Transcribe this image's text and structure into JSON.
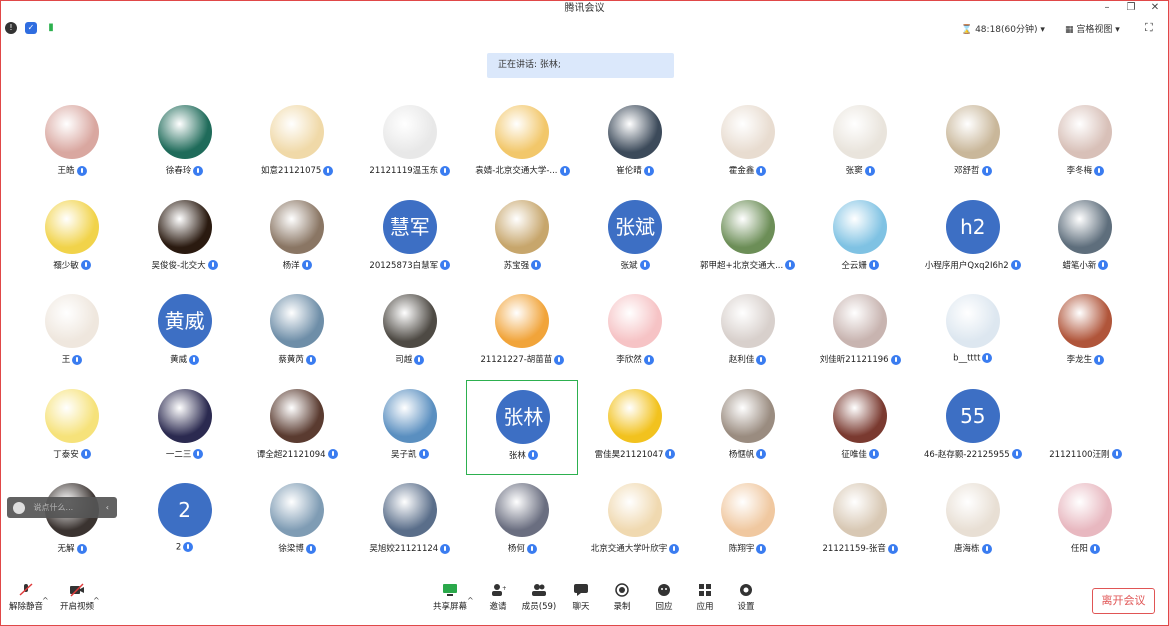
{
  "window": {
    "title": "腾讯会议"
  },
  "header": {
    "timer": "48:18(60分钟)",
    "view_mode": "宫格视图"
  },
  "speaking": {
    "text": "正在讲话: 张林;"
  },
  "participants": [
    {
      "name": "王皓",
      "avatar": "photo",
      "color": "#d9a7a0"
    },
    {
      "name": "徐春玲",
      "avatar": "photo",
      "color": "#1f6b5a"
    },
    {
      "name": "如意21121075",
      "avatar": "photo",
      "color": "#f0d9a8"
    },
    {
      "name": "21121119温玉东",
      "avatar": "photo",
      "color": "#e8e8e8"
    },
    {
      "name": "袁婧-北京交通大学-...",
      "avatar": "photo",
      "color": "#f2c76a"
    },
    {
      "name": "崔伦晴",
      "avatar": "photo",
      "color": "#3c4a5a"
    },
    {
      "name": "霍金鑫",
      "avatar": "photo",
      "color": "#e8dcd0"
    },
    {
      "name": "张窦",
      "avatar": "photo",
      "color": "#e9e4dc"
    },
    {
      "name": "邓舒哲",
      "avatar": "photo",
      "color": "#c9b79a"
    },
    {
      "name": "李冬梅",
      "avatar": "photo",
      "color": "#d8c0b8"
    },
    {
      "name": "禤少敏",
      "avatar": "photo",
      "color": "#f1d34a"
    },
    {
      "name": "吴俊俊-北交大",
      "avatar": "photo",
      "color": "#2a1a10"
    },
    {
      "name": "杨洋",
      "avatar": "photo",
      "color": "#8a7664"
    },
    {
      "name": "20125873白慧军",
      "avatar": "text",
      "text": "慧军"
    },
    {
      "name": "苏宝强",
      "avatar": "photo",
      "color": "#c7a66c"
    },
    {
      "name": "张斌",
      "avatar": "text",
      "text": "张斌"
    },
    {
      "name": "郭甲超+北京交通大...",
      "avatar": "photo",
      "color": "#6c8e57"
    },
    {
      "name": "仝云姗",
      "avatar": "photo",
      "color": "#7fc2e3"
    },
    {
      "name": "小程序用户Qxq2I6h2",
      "avatar": "text",
      "text": "h2"
    },
    {
      "name": "蜡笔小新",
      "avatar": "photo",
      "color": "#5e6e7c"
    },
    {
      "name": "王",
      "avatar": "photo",
      "color": "#efe7de"
    },
    {
      "name": "黄威",
      "avatar": "text",
      "text": "黄威"
    },
    {
      "name": "蔡黄芮",
      "avatar": "photo",
      "color": "#6e8ea8"
    },
    {
      "name": "司越",
      "avatar": "photo",
      "color": "#4e4a44"
    },
    {
      "name": "21121227-胡苗苗",
      "avatar": "photo",
      "color": "#f1a43a"
    },
    {
      "name": "李欣然",
      "avatar": "photo",
      "color": "#f6c3c5"
    },
    {
      "name": "赵利佳",
      "avatar": "photo",
      "color": "#d8d0cc"
    },
    {
      "name": "刘佳昕21121196",
      "avatar": "photo",
      "color": "#c8b4b0"
    },
    {
      "name": "b__tttt",
      "avatar": "photo",
      "color": "#dde7f0"
    },
    {
      "name": "李龙生",
      "avatar": "photo",
      "color": "#b0553a"
    },
    {
      "name": "丁泰安",
      "avatar": "photo",
      "color": "#f6e27a"
    },
    {
      "name": "一二三",
      "avatar": "photo",
      "color": "#2b2a50"
    },
    {
      "name": "谭全超21121094",
      "avatar": "photo",
      "color": "#5a3b30"
    },
    {
      "name": "吴子凯",
      "avatar": "photo",
      "color": "#5a8fc0"
    },
    {
      "name": "张林",
      "avatar": "text",
      "text": "张林",
      "active": true
    },
    {
      "name": "雷佳昊21121047",
      "avatar": "photo",
      "color": "#f2c21e"
    },
    {
      "name": "杨惬帆",
      "avatar": "photo",
      "color": "#9a8c80"
    },
    {
      "name": "征唯佳",
      "avatar": "photo",
      "color": "#7a3a30"
    },
    {
      "name": "46-赵存颢-22125955",
      "avatar": "text",
      "text": "55"
    },
    {
      "name": "21121100汪刚",
      "avatar": "photo",
      "color": "#ffffff"
    },
    {
      "name": "无解",
      "avatar": "photo",
      "color": "#3a3330"
    },
    {
      "name": "2",
      "avatar": "text",
      "text": "2"
    },
    {
      "name": "徐梁博",
      "avatar": "photo",
      "color": "#7f9cb4"
    },
    {
      "name": "吴旭姣21121124",
      "avatar": "photo",
      "color": "#5a6e8a"
    },
    {
      "name": "杨何",
      "avatar": "photo",
      "color": "#6a6e80"
    },
    {
      "name": "北京交通大学叶欣宇",
      "avatar": "photo",
      "color": "#f0d9b0"
    },
    {
      "name": "陈翔宇",
      "avatar": "photo",
      "color": "#f0c8a0"
    },
    {
      "name": "21121159-张音",
      "avatar": "photo",
      "color": "#d8c8b4"
    },
    {
      "name": "唐海栋",
      "avatar": "photo",
      "color": "#e8dfd4"
    },
    {
      "name": "任阳",
      "avatar": "photo",
      "color": "#e8b8c0"
    }
  ],
  "chat": {
    "placeholder": "说点什么..."
  },
  "bottom": {
    "mute": "解除静音",
    "video": "开启视频",
    "share": "共享屏幕",
    "invite": "邀请",
    "members": "成员(59)",
    "chat": "聊天",
    "record": "录制",
    "replay": "回应",
    "apps": "应用",
    "settings": "设置",
    "leave": "离开会议"
  },
  "colors": {
    "accent": "#3a7cf0",
    "text_avatar": "#3d6fc4",
    "leave": "#e05555",
    "active_border": "#2db04f"
  }
}
